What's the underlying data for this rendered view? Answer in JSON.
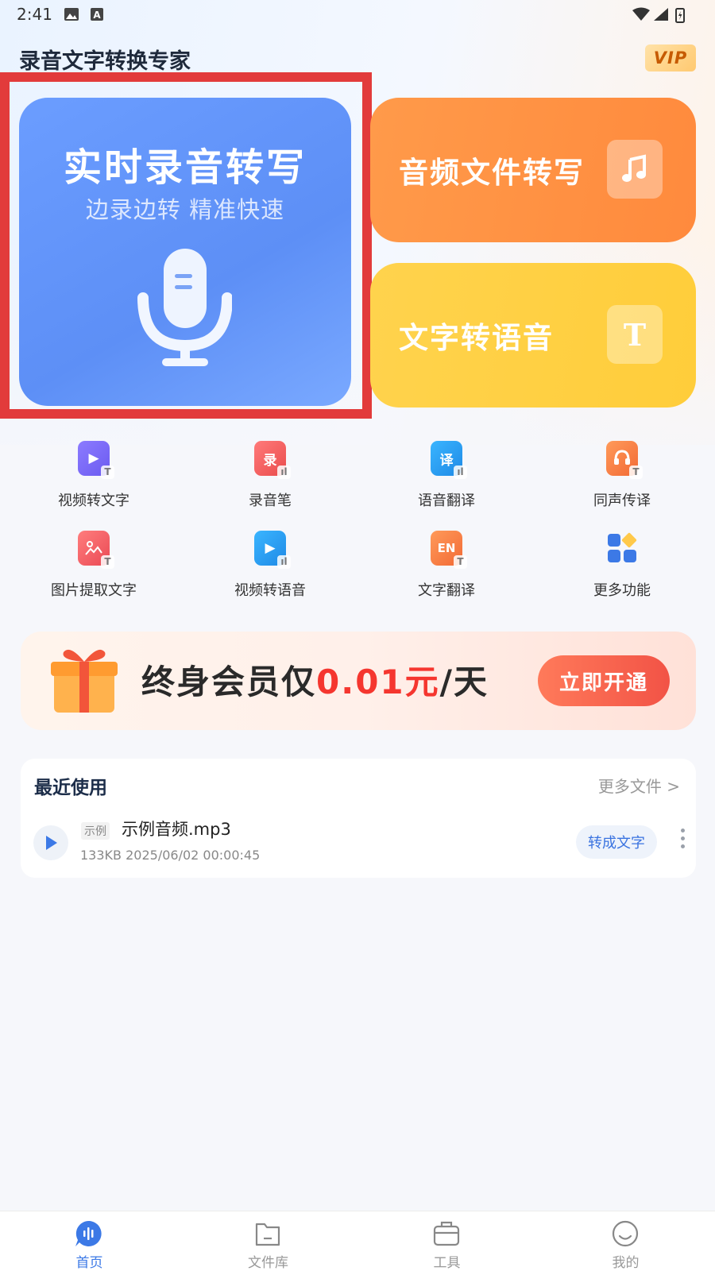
{
  "status_bar": {
    "time": "2:41"
  },
  "header": {
    "app_title": "录音文字转换专家",
    "vip_label": "VIP"
  },
  "hero": {
    "live": {
      "title": "实时录音转写",
      "subtitle": "边录边转 精准快速"
    },
    "audio_file": {
      "label": "音频文件转写",
      "icon": "music-note-icon"
    },
    "text_to_speech": {
      "label": "文字转语音",
      "icon": "text-t-icon",
      "icon_glyph": "T"
    }
  },
  "tools": [
    {
      "label": "视频转文字",
      "icon": "video-to-text-icon",
      "color": "#7b6cf6",
      "glyph": "▶"
    },
    {
      "label": "录音笔",
      "icon": "recorder-pen-icon",
      "color": "#f05a5a",
      "glyph": "录"
    },
    {
      "label": "语音翻译",
      "icon": "voice-translate-icon",
      "color": "#2b9cf2",
      "glyph": "译"
    },
    {
      "label": "同声传译",
      "icon": "simultaneous-interpretation-icon",
      "color": "#ff7b45",
      "glyph": "◎"
    },
    {
      "label": "图片提取文字",
      "icon": "image-to-text-icon",
      "color": "#f2585d",
      "glyph": "▲"
    },
    {
      "label": "视频转语音",
      "icon": "video-to-speech-icon",
      "color": "#2b9cf2",
      "glyph": "▶"
    },
    {
      "label": "文字翻译",
      "icon": "text-translate-icon",
      "color": "#ff7b45",
      "glyph": "EN"
    },
    {
      "label": "更多功能",
      "icon": "more-features-icon",
      "color": "#3c79e6",
      "glyph": ""
    }
  ],
  "promo": {
    "text_prefix": "终身会员仅",
    "price": "0.01元",
    "text_suffix": "/天",
    "button_label": "立即开通"
  },
  "recent": {
    "title": "最近使用",
    "more_label": "更多文件 >",
    "files": [
      {
        "tag": "示例",
        "name": "示例音频.mp3",
        "meta": "133KB 2025/06/02 00:00:45",
        "action_label": "转成文字"
      }
    ]
  },
  "bottom_nav": [
    {
      "label": "首页",
      "icon": "home-waveform-icon",
      "active": true
    },
    {
      "label": "文件库",
      "icon": "folder-icon",
      "active": false
    },
    {
      "label": "工具",
      "icon": "toolbox-icon",
      "active": false
    },
    {
      "label": "我的",
      "icon": "smile-profile-icon",
      "active": false
    }
  ],
  "colors": {
    "accent_blue": "#3c79e6",
    "highlight_red": "#e23b3b",
    "price_red": "#f5362f"
  }
}
